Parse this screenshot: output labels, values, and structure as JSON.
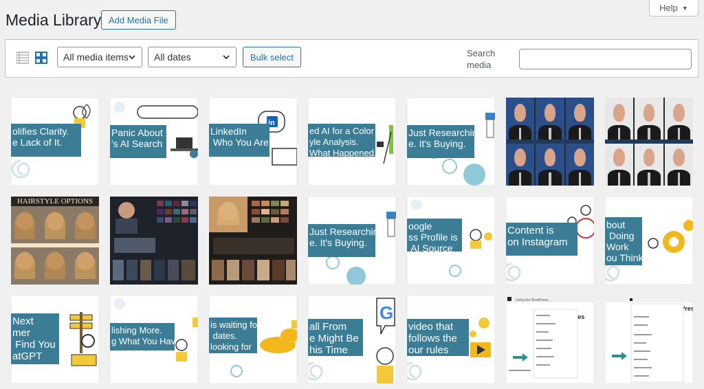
{
  "help": {
    "label": "Help",
    "caret": "▼"
  },
  "header": {
    "title": "Media Library",
    "add_label": "Add Media File"
  },
  "toolbar": {
    "type_filter": "All media items",
    "date_filter": "All dates",
    "bulk_label": "Bulk select",
    "search_label": "Search media",
    "search_value": ""
  },
  "colors": {
    "accent": "#2271b1",
    "banner": "#3b7d96"
  },
  "tiles": {
    "t1": "olifies Clarity.\ne Lack of It.",
    "t2": "Panic About\n's AI Search",
    "t3": "LinkedIn\n Who You Are?",
    "t3_badge": "in",
    "t4": "ed AI for a Color\nyle Analysis.\nWhat Happened.",
    "t5": "Just Researching\ne. It's Buying.",
    "t8": "HAIRSTYLE OPTIONS",
    "t11": "Just Researching\ne. It's Buying.",
    "t12": "oogle\nss Profile is\n AI Source",
    "t13": "Content is\non Instagram",
    "t14": "bout\n Doing\nWork\nou Think",
    "t15": "Next\nmer\n Find You\natGPT",
    "t16": "lishing More.\ng What You Have.",
    "t17": "is waiting for\n dates.\nlooking for",
    "t18": "all From\ne Might Be\nhis Time",
    "t18_logo": "G",
    "t19": "video that\nfollows the\nour rules",
    "t20_title": "Using the WordPress...",
    "t20_heading": "...ke WordPres",
    "t21_heading": "...ing the WordPres"
  }
}
